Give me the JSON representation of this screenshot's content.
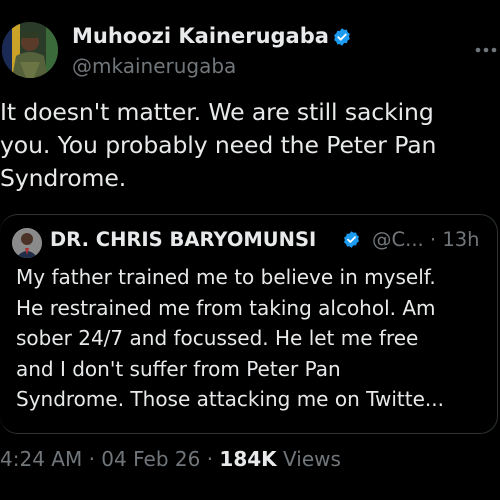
{
  "author": {
    "display_name": "Muhoozi Kainerugaba",
    "handle": "@mkainerugaba",
    "verified_icon": "verified-badge-icon",
    "accent": "#1d9bf0"
  },
  "tweet": {
    "lines": [
      "It doesn't matter. We are still sacking",
      "you. You probably need the Peter Pan",
      "Syndrome."
    ]
  },
  "quote": {
    "display_name": "DR. CHRIS BARYOMUNSI",
    "handle": "@C...",
    "separator": "·",
    "time": "13h",
    "lines": [
      "My father trained me to believe in myself.",
      "He restrained me from taking alcohol. Am",
      "sober 24/7 and focussed. He let me free",
      "and  I don't suffer from Peter Pan",
      "Syndrome. Those attacking me on Twitte..."
    ]
  },
  "footer": {
    "time": "4:24 AM",
    "separator": "·",
    "date": "04 Feb 26",
    "views_count": "184K",
    "views_label": "Views"
  },
  "colors": {
    "background": "#000000",
    "text": "#e7e9ea",
    "muted": "#71767b",
    "border": "#2f3336"
  }
}
